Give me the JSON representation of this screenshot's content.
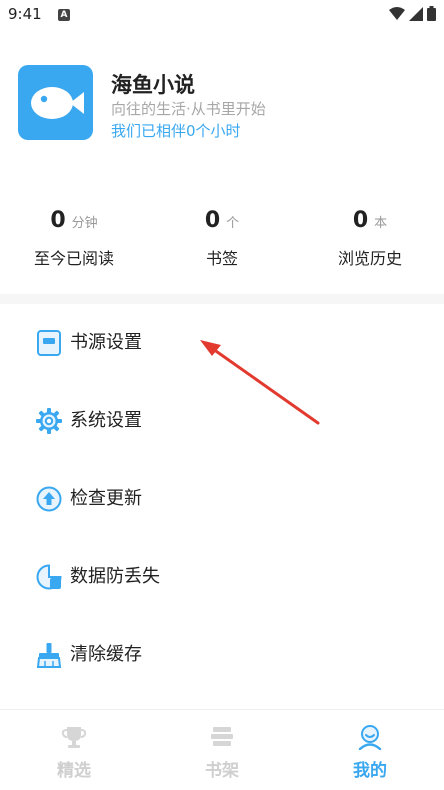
{
  "status_bar": {
    "time": "9:41",
    "notification_icon": "A"
  },
  "profile": {
    "app_name": "海鱼小说",
    "slogan": "向往的生活·从书里开始",
    "companion_text": "我们已相伴0个小时"
  },
  "stats": [
    {
      "value": "0",
      "unit": "分钟",
      "label": "至今已阅读"
    },
    {
      "value": "0",
      "unit": "个",
      "label": "书签"
    },
    {
      "value": "0",
      "unit": "本",
      "label": "浏览历史"
    }
  ],
  "menu": [
    {
      "label": "书源设置",
      "icon": "book-source-icon"
    },
    {
      "label": "系统设置",
      "icon": "gear-icon"
    },
    {
      "label": "检查更新",
      "icon": "upload-arrow-icon"
    },
    {
      "label": "数据防丢失",
      "icon": "data-backup-icon"
    },
    {
      "label": "清除缓存",
      "icon": "broom-icon"
    }
  ],
  "tabs": [
    {
      "label": "精选",
      "icon": "trophy-icon",
      "active": false
    },
    {
      "label": "书架",
      "icon": "bookshelf-icon",
      "active": false
    },
    {
      "label": "我的",
      "icon": "user-icon",
      "active": true
    }
  ],
  "colors": {
    "accent": "#3aa8f0",
    "inactive": "#cfcfcf",
    "arrow": "#e23a2f"
  }
}
